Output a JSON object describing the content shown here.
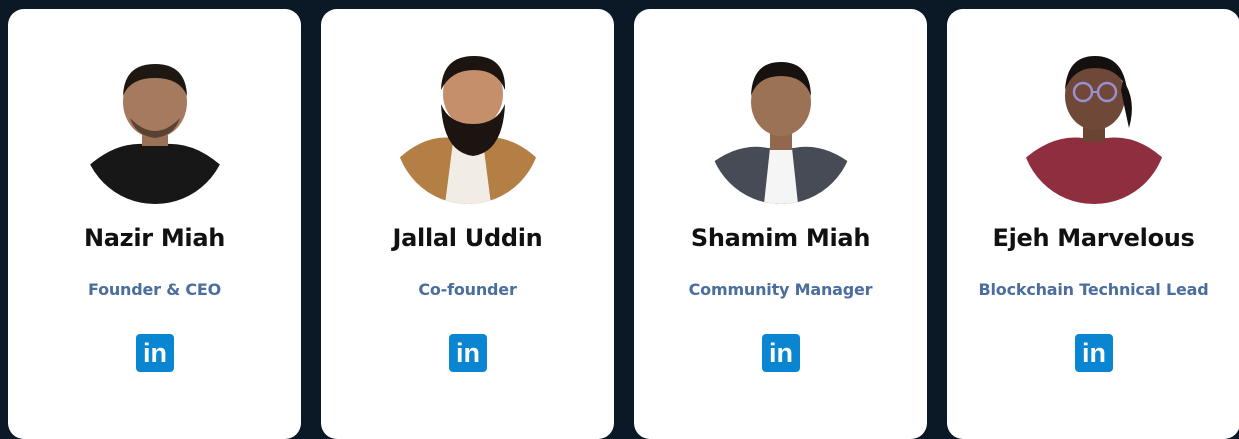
{
  "colors": {
    "page_background": "#0b1826",
    "card_background": "#ffffff",
    "name_text": "#111111",
    "role_text": "#4b6e9d",
    "linkedin_brand": "#0a85d1"
  },
  "team": [
    {
      "name": "Nazir Miah",
      "role": "Founder & CEO",
      "avatar_icon": "person-photo-icon",
      "social_icon": "linkedin-icon",
      "social_icon_text": "in"
    },
    {
      "name": "Jallal Uddin",
      "role": "Co-founder",
      "avatar_icon": "person-photo-icon",
      "social_icon": "linkedin-icon",
      "social_icon_text": "in"
    },
    {
      "name": "Shamim Miah",
      "role": "Community Manager",
      "avatar_icon": "person-photo-icon",
      "social_icon": "linkedin-icon",
      "social_icon_text": "in"
    },
    {
      "name": "Ejeh Marvelous",
      "role": "Blockchain Technical Lead",
      "avatar_icon": "person-photo-icon",
      "social_icon": "linkedin-icon",
      "social_icon_text": "in"
    }
  ]
}
